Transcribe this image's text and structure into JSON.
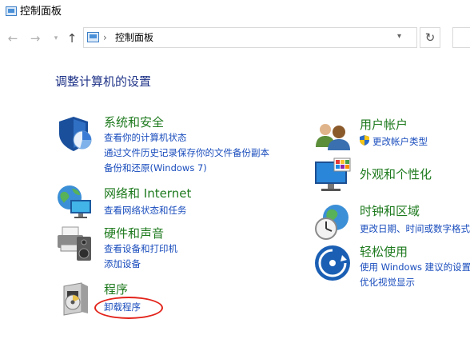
{
  "window": {
    "title": "控制面板"
  },
  "address_bar": {
    "path": "控制面板"
  },
  "main": {
    "heading": "调整计算机的设置",
    "left_categories": [
      {
        "title": "系统和安全",
        "links": [
          "查看你的计算机状态",
          "通过文件历史记录保存你的文件备份副本",
          "备份和还原(Windows 7)"
        ]
      },
      {
        "title": "网络和 Internet",
        "links": [
          "查看网络状态和任务"
        ]
      },
      {
        "title": "硬件和声音",
        "links": [
          "查看设备和打印机",
          "添加设备"
        ]
      },
      {
        "title": "程序",
        "links": [
          "卸载程序"
        ]
      }
    ],
    "right_categories": [
      {
        "title": "用户帐户",
        "links": [
          "更改帐户类型"
        ]
      },
      {
        "title": "外观和个性化",
        "links": []
      },
      {
        "title": "时钟和区域",
        "links": [
          "更改日期、时间或数字格式"
        ]
      },
      {
        "title": "轻松使用",
        "links": [
          "使用 Windows 建议的设置",
          "优化视觉显示"
        ]
      }
    ]
  },
  "annotation": {
    "color": "#e2231a"
  },
  "colors": {
    "heading": "#1e3287",
    "category": "#1e7a1e",
    "link": "#1a4dbd"
  }
}
